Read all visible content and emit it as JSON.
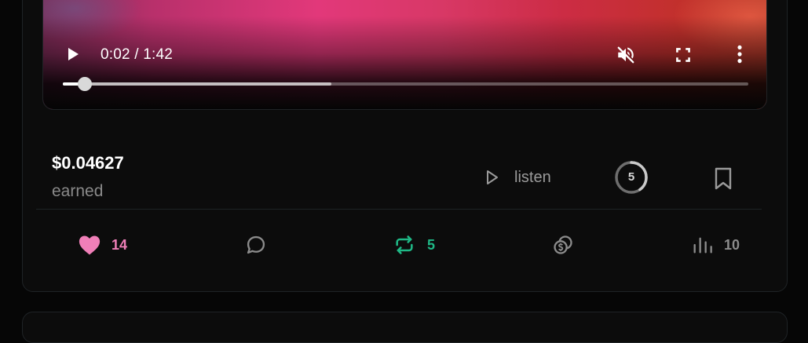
{
  "player": {
    "time_display": "0:02 / 1:42",
    "progress_played": 0.032,
    "progress_buffered": 0.392,
    "icons": {
      "play": "play-icon",
      "mute": "volume-muted-icon",
      "fullscreen": "fullscreen-icon",
      "more": "more-vertical-icon"
    }
  },
  "earnings": {
    "amount": "$0.04627",
    "label": "earned"
  },
  "actions_top": {
    "listen_label": "listen",
    "timer_value": "5"
  },
  "actions_bottom": {
    "likes": "14",
    "reposts": "5",
    "views": "10"
  },
  "colors": {
    "like": "#f07fb8",
    "repost": "#1fb886",
    "muted_text": "#8a8a8a",
    "background": "#0c0c0c"
  }
}
